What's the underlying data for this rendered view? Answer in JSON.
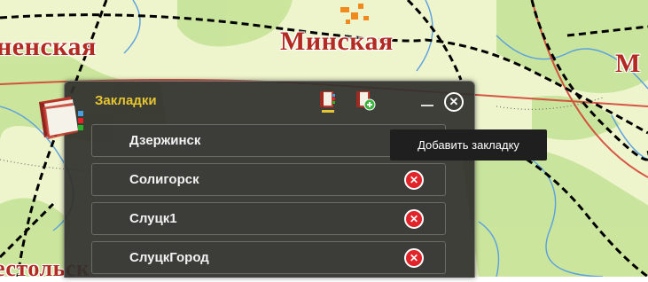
{
  "map": {
    "labels": {
      "left": "ненская",
      "center": "Минская",
      "right": "М",
      "bottom": "естольск"
    }
  },
  "panel": {
    "title": "Закладки",
    "tools": [
      {
        "icon": "bookmark-list-icon",
        "active": true
      },
      {
        "icon": "add-bookmark-icon",
        "active": false
      }
    ],
    "bookmarks": [
      {
        "label": "Дзержинск"
      },
      {
        "label": "Солигорск"
      },
      {
        "label": "Слуцк1"
      },
      {
        "label": "СлуцкГород"
      }
    ]
  },
  "tooltip": {
    "text": "Добавить закладку"
  },
  "colors": {
    "accent_title": "#e6c532",
    "delete_red": "#e0242a",
    "region_label": "#b22a22",
    "map_bg": "#ecf3c7",
    "forest": "#c8e59a"
  }
}
